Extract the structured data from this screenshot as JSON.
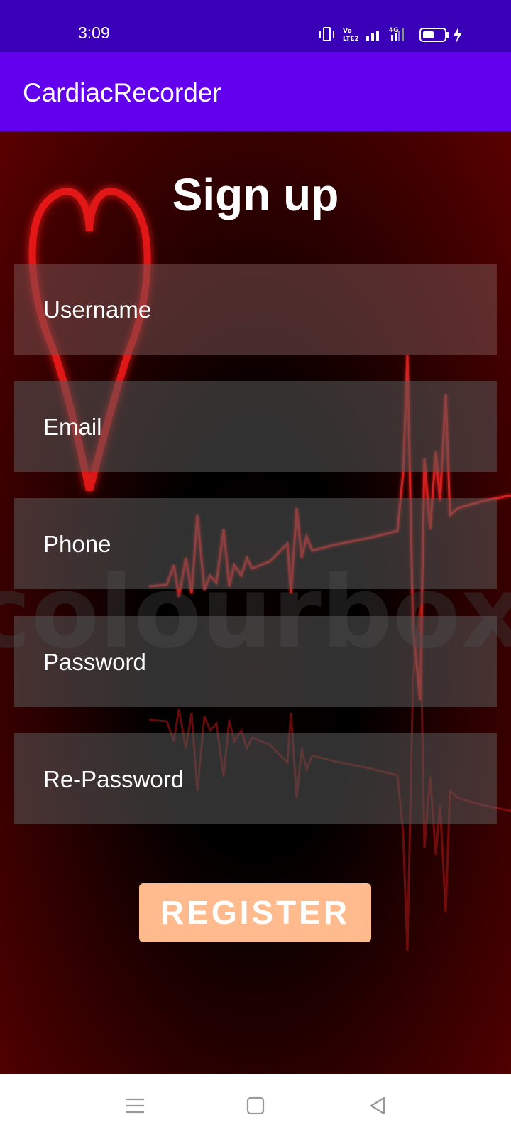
{
  "status_bar": {
    "time": "3:09",
    "icons": [
      "vibrate-icon",
      "volte-icon",
      "signal-icon",
      "4g-signal-icon",
      "battery-icon",
      "charging-icon"
    ],
    "background": "#3a00b7"
  },
  "app_bar": {
    "title": "CardiacRecorder",
    "background": "#6200ee"
  },
  "signup": {
    "heading": "Sign up",
    "fields": {
      "username": "Username",
      "email": "Email",
      "phone": "Phone",
      "password": "Password",
      "repassword": "Re-Password"
    },
    "register_label": "REGISTER",
    "register_color": "#ffbb8e"
  },
  "background_image": {
    "watermark": "colourbox"
  },
  "nav_bar": {
    "icons": [
      "menu-icon",
      "home-icon",
      "back-icon"
    ]
  }
}
